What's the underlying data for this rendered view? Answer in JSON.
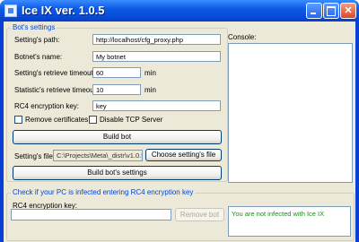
{
  "window": {
    "title": "Ice IX ver. 1.0.5"
  },
  "bot_settings": {
    "legend": "Bot's settings",
    "settings_path": {
      "label": "Setting's path:",
      "value": "http://localhost/cfg_proxy.php"
    },
    "botnet_name": {
      "label": "Botnet's name:",
      "value": "My botnet"
    },
    "settings_retrieve_timeout": {
      "label": "Setting's retrieve timeout:",
      "value": "60",
      "unit": "min"
    },
    "statistics_retrieve_timeout": {
      "label": "Statistic's retrieve timeout:",
      "value": "10",
      "unit": "min"
    },
    "rc4_key": {
      "label": "RC4 encryption key:",
      "value": "key"
    },
    "remove_certificates_label": "Remove certificates",
    "disable_tcp_server_label": "Disable TCP Server",
    "build_bot_label": "Build bot",
    "settings_file": {
      "label": "Setting's file:",
      "value": "C:\\Projects\\Meta\\_distr\\v1.0.5"
    },
    "choose_settings_file_label": "Choose setting's file",
    "build_bots_settings_label": "Build bot's settings"
  },
  "console": {
    "label": "Console:"
  },
  "infection_check": {
    "legend": "Check if your PC is infected entering RC4 encryption key",
    "rc4_label": "RC4 encryption key:",
    "rc4_value": "",
    "remove_bot_label": "Remove bot",
    "status_text": "You are not infected with Ice IX"
  },
  "colors": {
    "title_bar": "#0d5be4",
    "legend_text": "#0046d5",
    "status_text": "#1a8f1a",
    "window_bg": "#ece9d8"
  }
}
